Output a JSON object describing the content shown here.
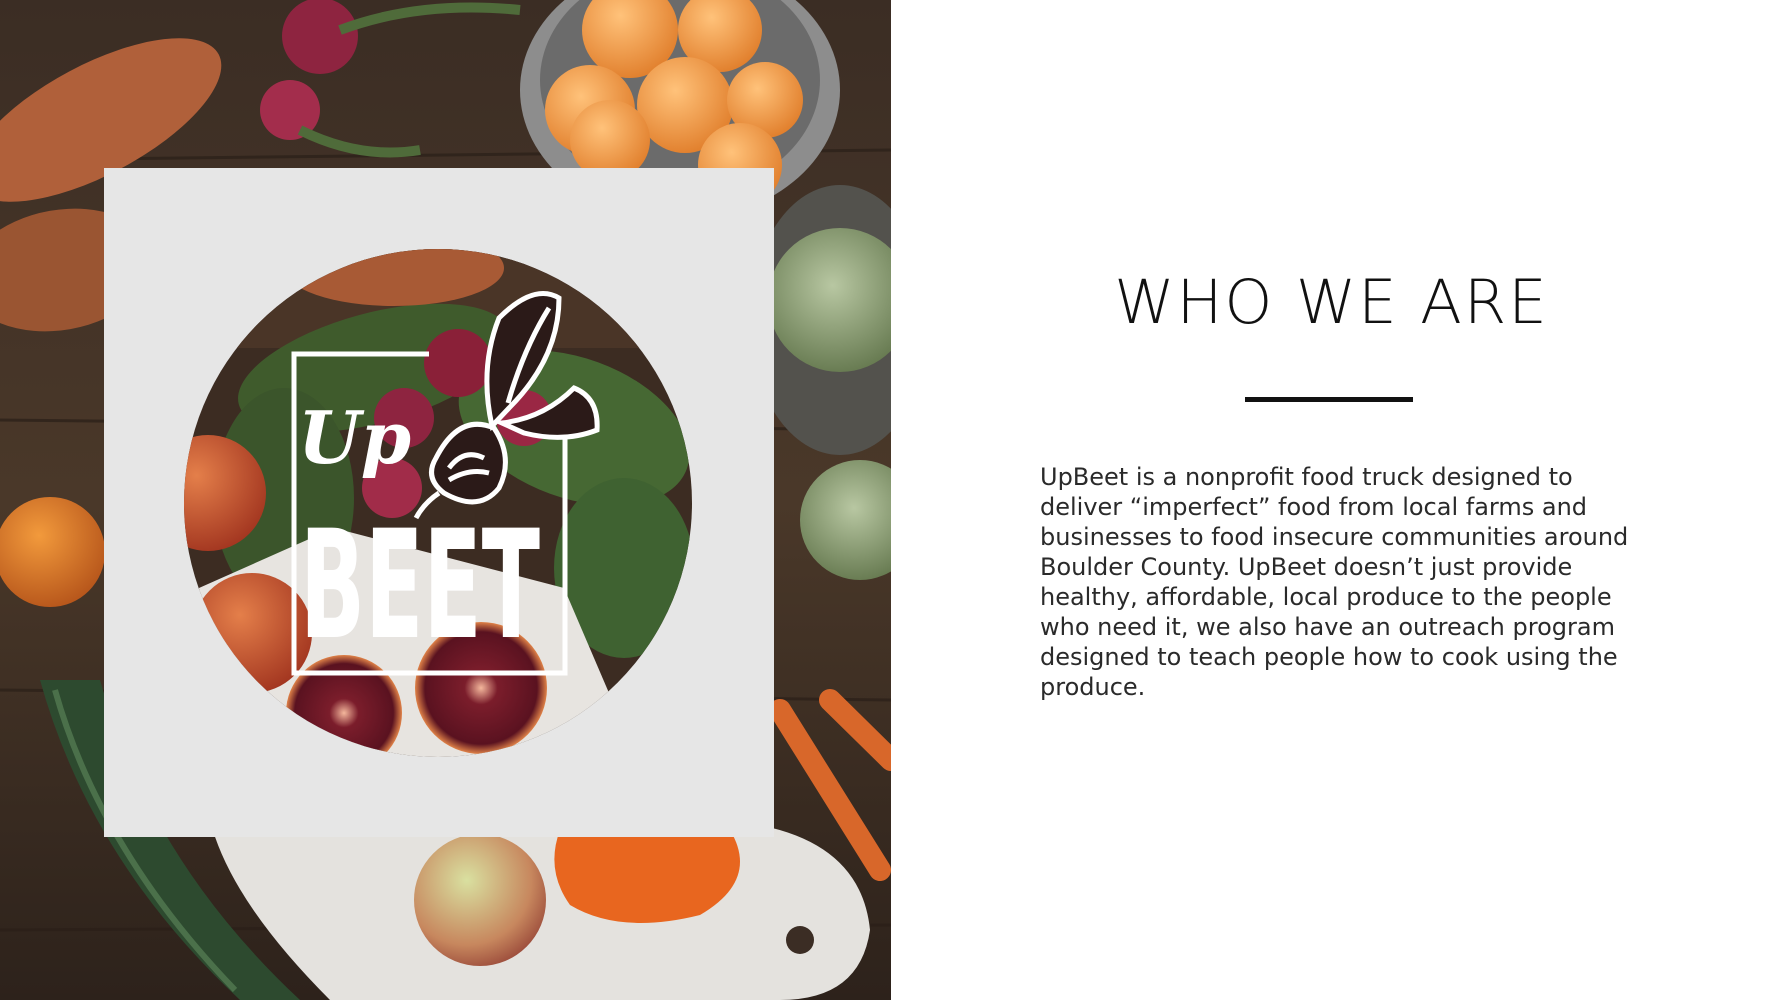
{
  "logo": {
    "word_up": "Up",
    "word_beet": "BEET"
  },
  "section": {
    "title": "WHO WE ARE",
    "body": "UpBeet is a nonprofit food truck designed to deliver “imperfect” food from local farms and businesses to food insecure communities around Boulder County. UpBeet doesn’t just provide healthy, affordable, local produce to the people who need it, we also have an outreach program designed to teach people how to cook using the produce."
  },
  "colors": {
    "accent": "#111111",
    "card_background": "#e6e6e6",
    "page_background": "#ffffff"
  }
}
